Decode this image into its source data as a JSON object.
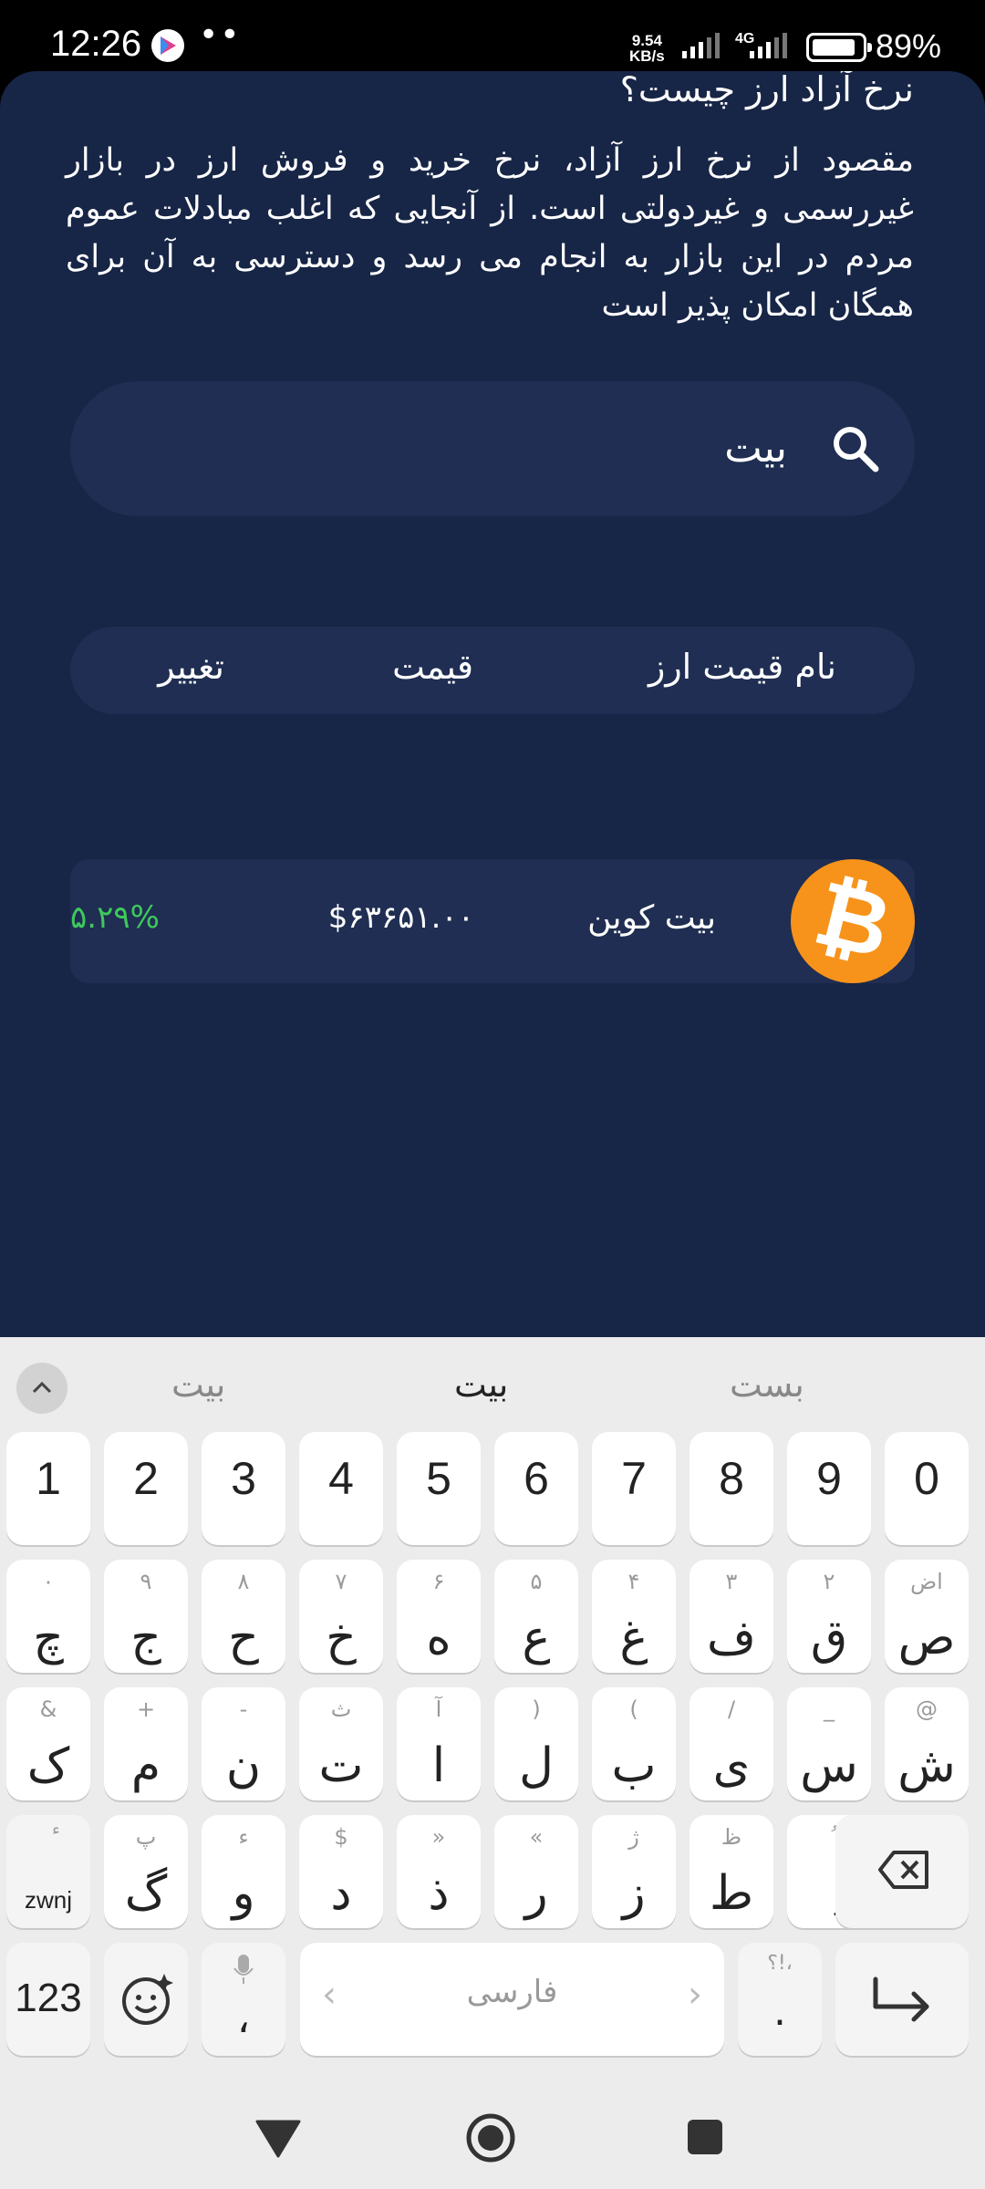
{
  "status_bar": {
    "time": "12:26",
    "dots": "••",
    "net_speed_value": "9.54",
    "net_speed_unit": "KB/s",
    "network_type": "4G",
    "battery_percent": "89%",
    "battery_level": 0.89
  },
  "info": {
    "title": "نرخ آزاد ارز چیست؟",
    "description": "مقصود از نرخ ارز آزاد، نرخ خرید و فروش ارز در بازار غیررسمی و غیردولتی است. از آنجایی که اغلب مبادلات عموم مردم در این بازار به انجام می رسد و دسترسی به آن برای همگان امکان پذیر است"
  },
  "search": {
    "value": "بیت",
    "icon": "search-icon"
  },
  "table": {
    "headers": {
      "name": "نام قیمت ارز",
      "price": "قیمت",
      "change": "تغییر"
    },
    "rows": [
      {
        "name": "بیت کوین",
        "price": "$۶۳۶۵۱.۰۰",
        "change": "۵.۲۹%",
        "logo_glyph": "₿",
        "logo_color": "#f7931a",
        "change_color": "#3ec95c"
      }
    ]
  },
  "keyboard": {
    "suggestions": [
      "بست",
      "بیت",
      "بیت"
    ],
    "number_row": [
      "1",
      "2",
      "3",
      "4",
      "5",
      "6",
      "7",
      "8",
      "9",
      "0"
    ],
    "row1": [
      {
        "main": "ص",
        "sub": "اض"
      },
      {
        "main": "ق",
        "sub": "۲"
      },
      {
        "main": "ف",
        "sub": "۳"
      },
      {
        "main": "غ",
        "sub": "۴"
      },
      {
        "main": "ع",
        "sub": "۵"
      },
      {
        "main": "ه",
        "sub": "۶"
      },
      {
        "main": "خ",
        "sub": "۷"
      },
      {
        "main": "ح",
        "sub": "۸"
      },
      {
        "main": "ج",
        "sub": "۹"
      },
      {
        "main": "چ",
        "sub": "۰"
      }
    ],
    "row2": [
      {
        "main": "ش",
        "sub": "@"
      },
      {
        "main": "س",
        "sub": "_"
      },
      {
        "main": "ی",
        "sub": "/"
      },
      {
        "main": "ب",
        "sub": "("
      },
      {
        "main": "ل",
        "sub": ")"
      },
      {
        "main": "ا",
        "sub": "آ"
      },
      {
        "main": "ت",
        "sub": "ث"
      },
      {
        "main": "ن",
        "sub": "-"
      },
      {
        "main": "م",
        "sub": "+"
      },
      {
        "main": "ک",
        "sub": "&"
      }
    ],
    "row3": [
      {
        "main": "ِ",
        "sub": "ُ"
      },
      {
        "main": "ط",
        "sub": "ظ"
      },
      {
        "main": "ز",
        "sub": "ژ"
      },
      {
        "main": "ر",
        "sub": "«"
      },
      {
        "main": "ذ",
        "sub": "»"
      },
      {
        "main": "د",
        "sub": "$"
      },
      {
        "main": "و",
        "sub": "ء"
      },
      {
        "main": "گ",
        "sub": "پ"
      }
    ],
    "zwnj_label": "zwnj",
    "zwnj_sub": "ٔ",
    "numbers_label": "123",
    "comma_label": "،",
    "space_label": "فارسی",
    "period_label": ".",
    "period_sub": "؟!،"
  }
}
